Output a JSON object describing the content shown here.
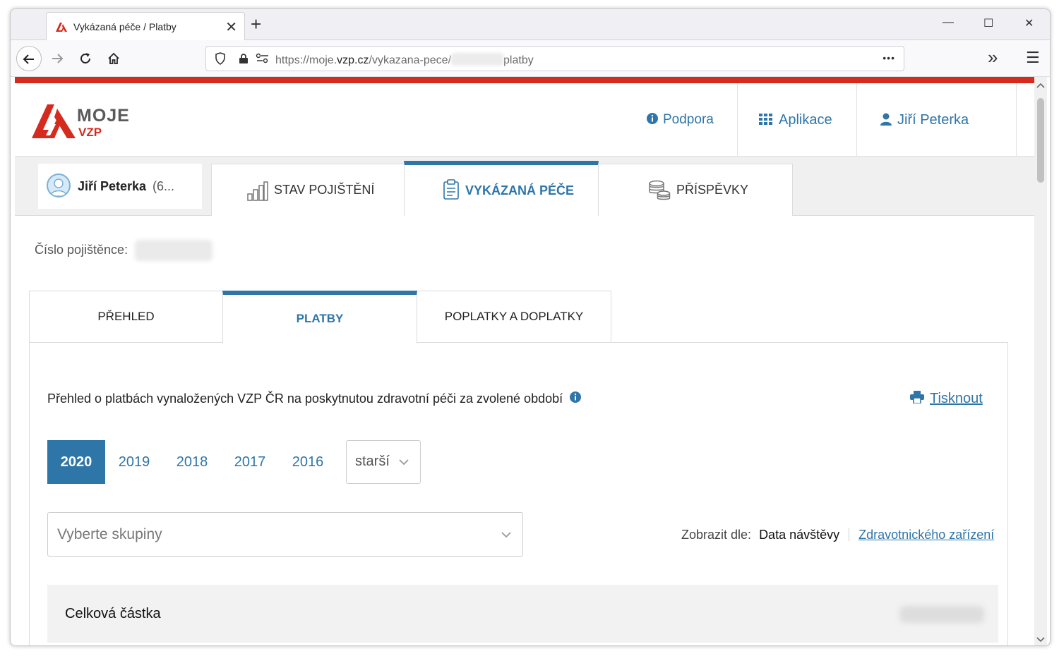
{
  "browser": {
    "tab_title": "Vykázaná péče / Platby",
    "tab_close": "✕",
    "new_tab": "+",
    "url_prefix": "https://moje.",
    "url_domain": "vzp.cz",
    "url_path": "/vykazana-pece/",
    "url_suffix": "platby",
    "page_actions": "•••",
    "overflow": "»",
    "menu": "☰",
    "minimize": "—",
    "maximize": "☐",
    "close": "✕"
  },
  "header": {
    "logo_moje": "MOJE",
    "logo_vzp": "VZP",
    "support": "Podpora",
    "apps": "Aplikace",
    "user": "Jiří Peterka"
  },
  "user_card": {
    "name": "Jiří Peterka",
    "suffix": "(6..."
  },
  "main_tabs": [
    {
      "label": "STAV POJIŠTĚNÍ",
      "active": false
    },
    {
      "label": "VYKÁZANÁ PÉČE",
      "active": true
    },
    {
      "label": "PŘÍSPĚVKY",
      "active": false
    }
  ],
  "insured": {
    "label": "Číslo pojištěnce:"
  },
  "sub_tabs": [
    {
      "label": "PŘEHLED",
      "active": false
    },
    {
      "label": "PLATBY",
      "active": true
    },
    {
      "label": "POPLATKY A DOPLATKY",
      "active": false
    }
  ],
  "panel": {
    "info_text": "Přehled o platbách vynaložených VZP ČR na poskytnutou zdravotní péči za zvolené období",
    "print": "Tisknout",
    "years": [
      "2020",
      "2019",
      "2018",
      "2017",
      "2016"
    ],
    "active_year": "2020",
    "older": "starší",
    "group_placeholder": "Vyberte skupiny",
    "show_by_label": "Zobrazit dle:",
    "show_by_current": "Data návštěvy",
    "show_by_alt": "Zdravotnického zařízení",
    "total_label": "Celková částka"
  },
  "colors": {
    "accent": "#2e75a8",
    "brand_red": "#d52b1e"
  }
}
